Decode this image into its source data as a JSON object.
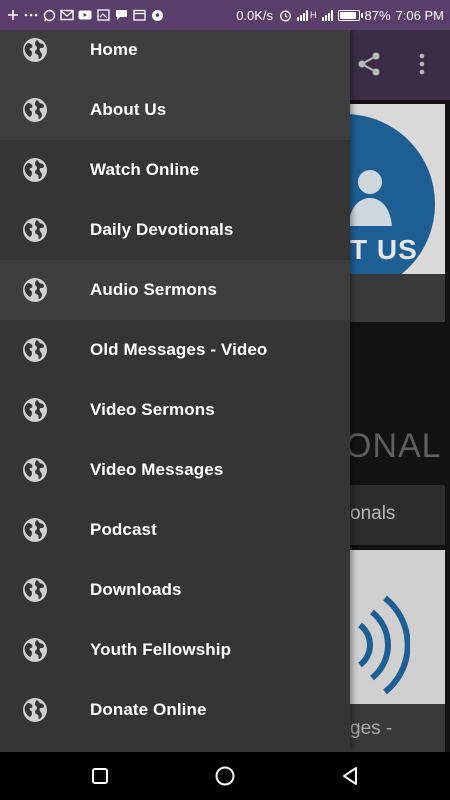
{
  "status_bar": {
    "network_speed": "0.0K/s",
    "network_type": "H",
    "battery_percent": "87%",
    "time": "7:06 PM",
    "left_icons": [
      "plus-icon",
      "more-dots-icon",
      "whatsapp-icon",
      "gmail-icon",
      "youtube-icon",
      "image-icon",
      "chat-icon",
      "calendar-icon",
      "soccer-icon"
    ],
    "bg_color": "#5a3f6c"
  },
  "app_bar": {
    "bg_color": "#3c2d47",
    "icons": [
      "share-icon",
      "overflow-menu-icon"
    ]
  },
  "background_cards": {
    "card1_text": "T US",
    "card2_text": "ONAL",
    "card2_footer": "onals",
    "card3_footer": "ges -"
  },
  "drawer": {
    "bg_color": "#353535",
    "item_icon": "globe-icon",
    "items": [
      {
        "label": "Home"
      },
      {
        "label": "About Us"
      },
      {
        "label": "Watch Online"
      },
      {
        "label": "Daily Devotionals"
      },
      {
        "label": "Audio Sermons"
      },
      {
        "label": "Old Messages - Video"
      },
      {
        "label": "Video Sermons"
      },
      {
        "label": "Video Messages"
      },
      {
        "label": "Podcast"
      },
      {
        "label": "Downloads"
      },
      {
        "label": "Youth Fellowship"
      },
      {
        "label": "Donate Online"
      }
    ]
  },
  "nav_bar": {
    "buttons": [
      "recents-icon",
      "home-icon",
      "back-icon"
    ]
  }
}
